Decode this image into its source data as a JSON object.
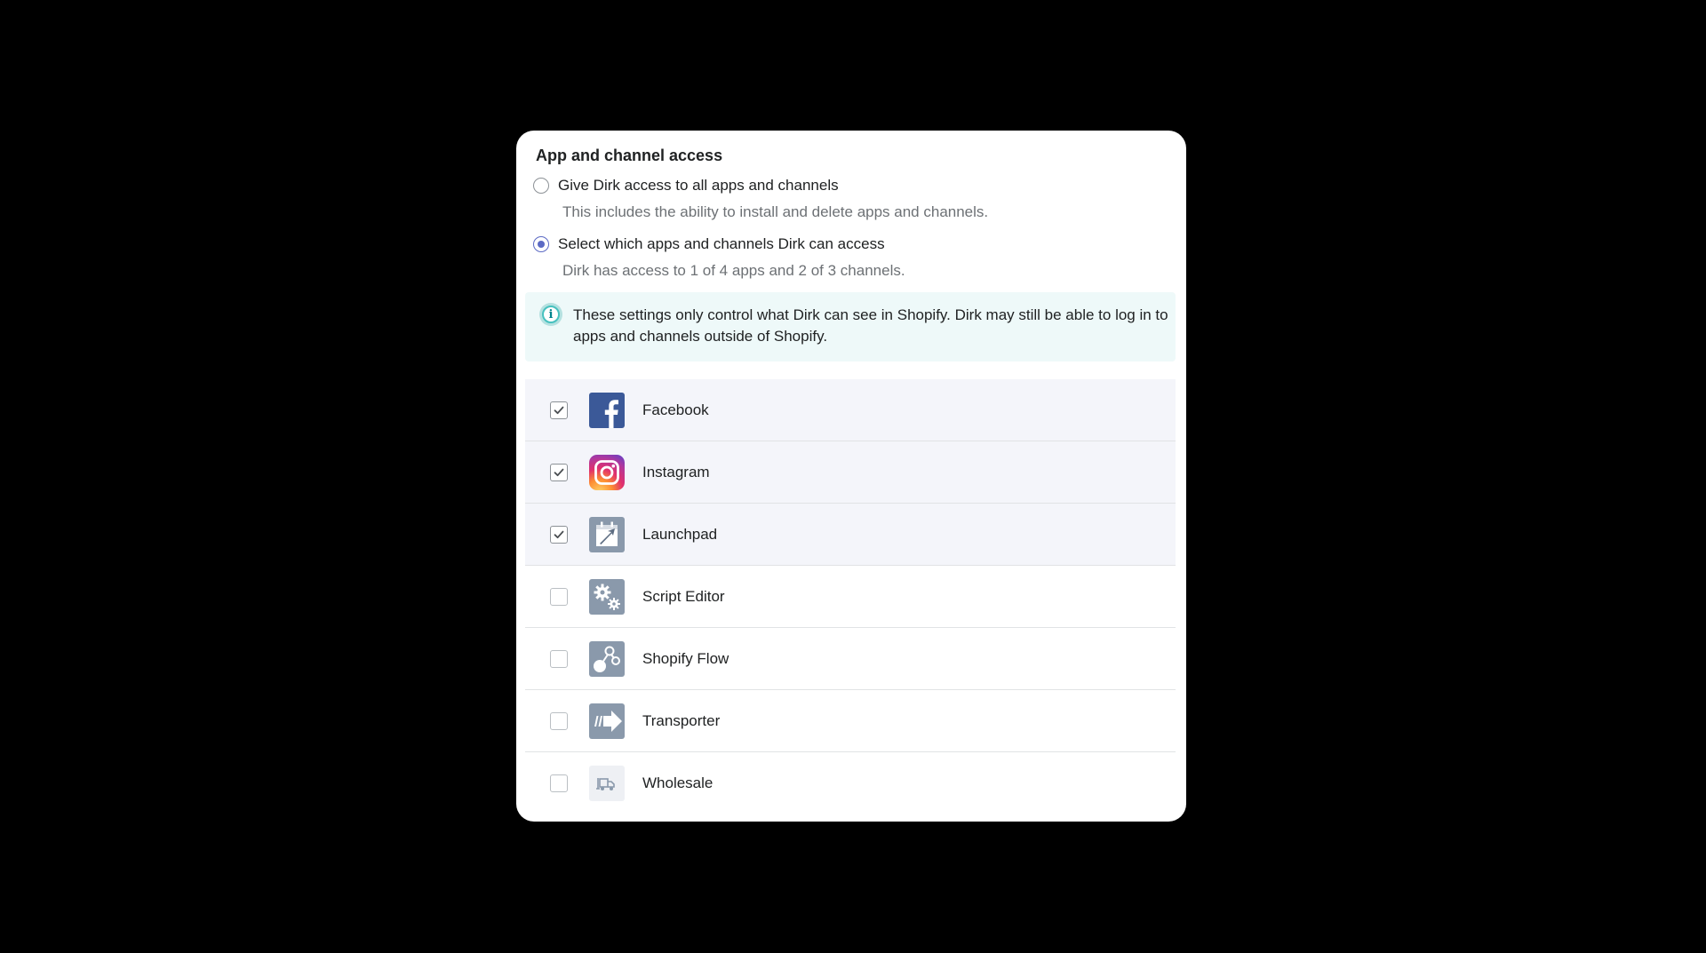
{
  "section": {
    "title": "App and channel access"
  },
  "options": [
    {
      "label": "Give Dirk access to all apps and channels",
      "help": "This includes the ability to install and delete apps and channels.",
      "selected": false
    },
    {
      "label": "Select which apps and channels Dirk can access",
      "help": "Dirk has access to 1 of 4 apps and 2 of 3 channels.",
      "selected": true
    }
  ],
  "banner": {
    "icon": "info-icon",
    "text": "These settings only control what Dirk can see in Shopify. Dirk may still be able to log in to apps and channels outside of Shopify."
  },
  "apps": [
    {
      "name": "Facebook",
      "checked": true,
      "icon": "facebook-icon"
    },
    {
      "name": "Instagram",
      "checked": true,
      "icon": "instagram-icon"
    },
    {
      "name": "Launchpad",
      "checked": true,
      "icon": "launchpad-icon"
    },
    {
      "name": "Script Editor",
      "checked": false,
      "icon": "script-editor-icon"
    },
    {
      "name": "Shopify Flow",
      "checked": false,
      "icon": "shopify-flow-icon"
    },
    {
      "name": "Transporter",
      "checked": false,
      "icon": "transporter-icon"
    },
    {
      "name": "Wholesale",
      "checked": false,
      "icon": "wholesale-icon"
    }
  ],
  "colors": {
    "accent": "#5c6ac4",
    "banner_bg": "#eef9f9",
    "checked_row_bg": "#f4f5fa",
    "facebook": "#3b5998",
    "app_gray": "#8a99ab"
  }
}
